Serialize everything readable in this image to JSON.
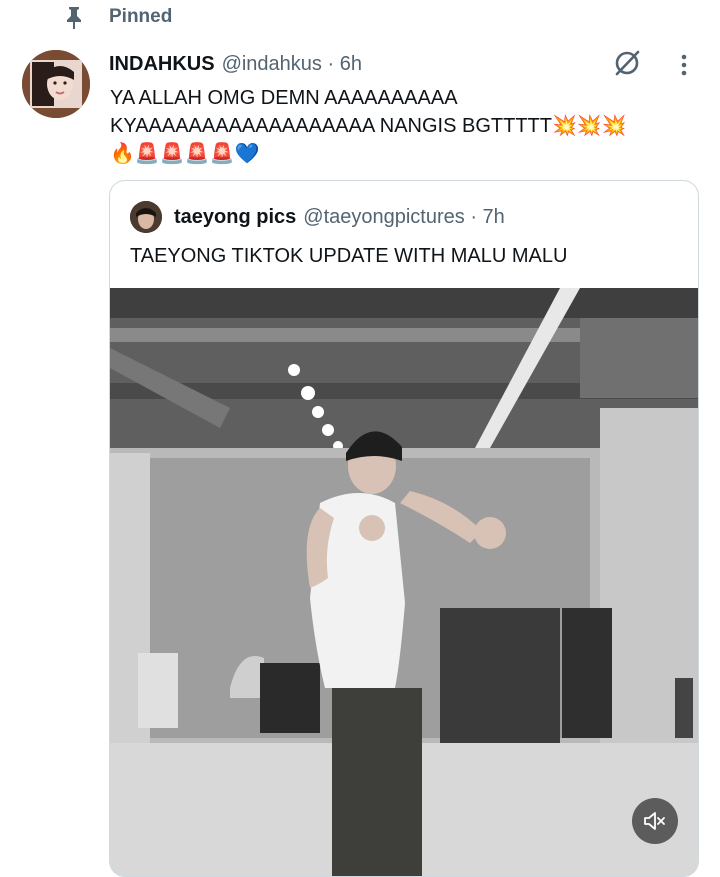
{
  "pinned_label": "Pinned",
  "author": {
    "name": "INDAHKUS",
    "handle_time": "@indahkus · 6h"
  },
  "tweet": {
    "text": "YA ALLAH OMG DEMN AAAAAAAAAA\nKYAAAAAAAAAAAAAAAAAA NANGIS BGTTTTT💥💥💥\n🔥🚨🚨🚨🚨💙"
  },
  "quote": {
    "name": "taeyong pics",
    "handle_time": "@taeyongpictures · 7h",
    "text": "TAEYONG TIKTOK UPDATE WITH MALU MALU"
  },
  "icons": {
    "pin": "pin-icon",
    "grok": "grok-icon",
    "more": "more-vertical-icon",
    "sound": "speaker-muted-icon"
  },
  "colors": {
    "text": "#0f1419",
    "secondary": "#536471",
    "border": "#cfd9de"
  }
}
